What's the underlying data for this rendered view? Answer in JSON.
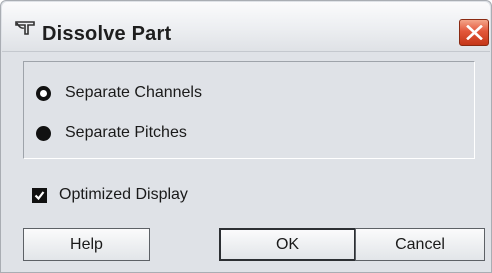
{
  "window": {
    "title": "Dissolve Part",
    "icon": "cubase-part-icon",
    "close_icon": "close-icon"
  },
  "options_group": {
    "radios": [
      {
        "label": "Separate Channels",
        "selected": true
      },
      {
        "label": "Separate Pitches",
        "selected": false
      }
    ]
  },
  "checkbox": {
    "label": "Optimized Display",
    "checked": true
  },
  "buttons": {
    "help": "Help",
    "ok": "OK",
    "cancel": "Cancel"
  },
  "colors": {
    "dialog_bg": "#dfe2e7",
    "close_button": "#d9482a"
  }
}
